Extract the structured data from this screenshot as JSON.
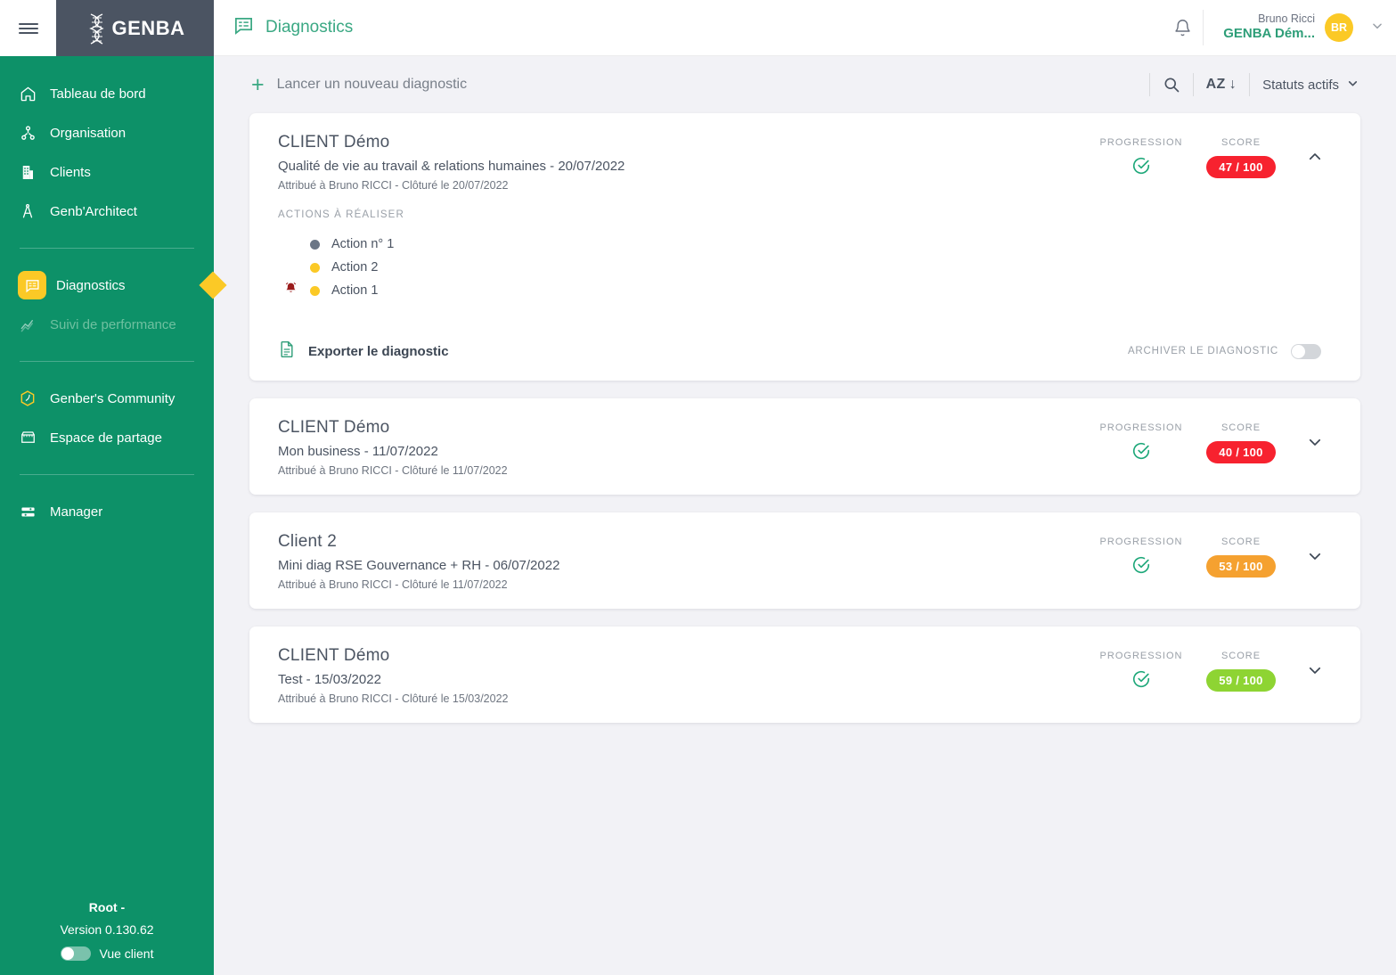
{
  "brand": {
    "logo_text": "GENBA",
    "logo_icon": "dna-helix-icon",
    "sidebar_color": "#0d9168",
    "accent_yellow": "#fbc926",
    "accent_green": "#3aa883"
  },
  "sidebar": {
    "items": [
      {
        "label": "Tableau de bord",
        "icon": "home-icon",
        "state": "normal"
      },
      {
        "label": "Organisation",
        "icon": "organization-icon",
        "state": "normal"
      },
      {
        "label": "Clients",
        "icon": "building-icon",
        "state": "normal"
      },
      {
        "label": "Genb'Architect",
        "icon": "compass-icon",
        "state": "normal"
      },
      {
        "label": "Diagnostics",
        "icon": "diagnostics-icon",
        "state": "active"
      },
      {
        "label": "Suivi de performance",
        "icon": "chart-line-icon",
        "state": "disabled"
      },
      {
        "label": "Genber's Community",
        "icon": "community-badge-icon",
        "state": "normal"
      },
      {
        "label": "Espace de partage",
        "icon": "store-icon",
        "state": "normal"
      },
      {
        "label": "Manager",
        "icon": "manager-icon",
        "state": "normal"
      }
    ],
    "footer": {
      "root": "Root -",
      "version": "Version 0.130.62",
      "client_view_label": "Vue client",
      "client_view_on": false
    }
  },
  "header": {
    "menu_icon": "hamburger-icon",
    "title": "Diagnostics",
    "title_icon": "diagnostics-icon",
    "bell_icon": "notification-bell-icon",
    "user": {
      "name": "Bruno Ricci",
      "org": "GENBA Dém...",
      "initials": "BR"
    },
    "caret_icon": "chevron-down-icon"
  },
  "toolbar": {
    "new_diagnostic_label": "Lancer un nouveau diagnostic",
    "new_diagnostic_icon": "plus-icon",
    "search_icon": "search-icon",
    "sort_label": "AZ",
    "sort_arrow": "↓",
    "status_filter_label": "Statuts actifs",
    "status_filter_icon": "chevron-down-icon"
  },
  "labels": {
    "progression": "PROGRESSION",
    "score": "SCORE",
    "actions_title": "ACTIONS À RÉALISER",
    "export_label": "Exporter le diagnostic",
    "archive_label": "ARCHIVER LE DIAGNOSTIC"
  },
  "diagnostics": [
    {
      "client": "CLIENT Démo",
      "subtitle": "Qualité de vie au travail & relations humaines - 20/07/2022",
      "meta": "Attribué à Bruno RICCI - Clôturé le 20/07/2022",
      "progression_icon": "check-circle-icon",
      "score": "47 / 100",
      "score_color": "#f7222f",
      "expanded": true,
      "chevron": "chevron-up-icon",
      "actions": [
        {
          "label": "Action n° 1",
          "dot_color": "#6b7686",
          "alarm": false
        },
        {
          "label": "Action 2",
          "dot_color": "#fbc926",
          "alarm": false
        },
        {
          "label": "Action 1",
          "dot_color": "#fbc926",
          "alarm": true
        }
      ],
      "archive_on": false
    },
    {
      "client": "CLIENT Démo",
      "subtitle": "Mon business - 11/07/2022",
      "meta": "Attribué à Bruno RICCI - Clôturé le 11/07/2022",
      "progression_icon": "check-circle-icon",
      "score": "40 / 100",
      "score_color": "#f7222f",
      "expanded": false,
      "chevron": "chevron-down-icon",
      "actions": [],
      "archive_on": false
    },
    {
      "client": "Client 2",
      "subtitle": "Mini diag RSE Gouvernance + RH - 06/07/2022",
      "meta": "Attribué à Bruno RICCI - Clôturé le 11/07/2022",
      "progression_icon": "check-circle-icon",
      "score": "53 / 100",
      "score_color": "#f5a130",
      "expanded": false,
      "chevron": "chevron-down-icon",
      "actions": [],
      "archive_on": false
    },
    {
      "client": "CLIENT Démo",
      "subtitle": "Test - 15/03/2022",
      "meta": "Attribué à Bruno RICCI - Clôturé le 15/03/2022",
      "progression_icon": "check-circle-icon",
      "score": "59 / 100",
      "score_color": "#8ed433",
      "expanded": false,
      "chevron": "chevron-down-icon",
      "actions": [],
      "archive_on": false
    }
  ]
}
